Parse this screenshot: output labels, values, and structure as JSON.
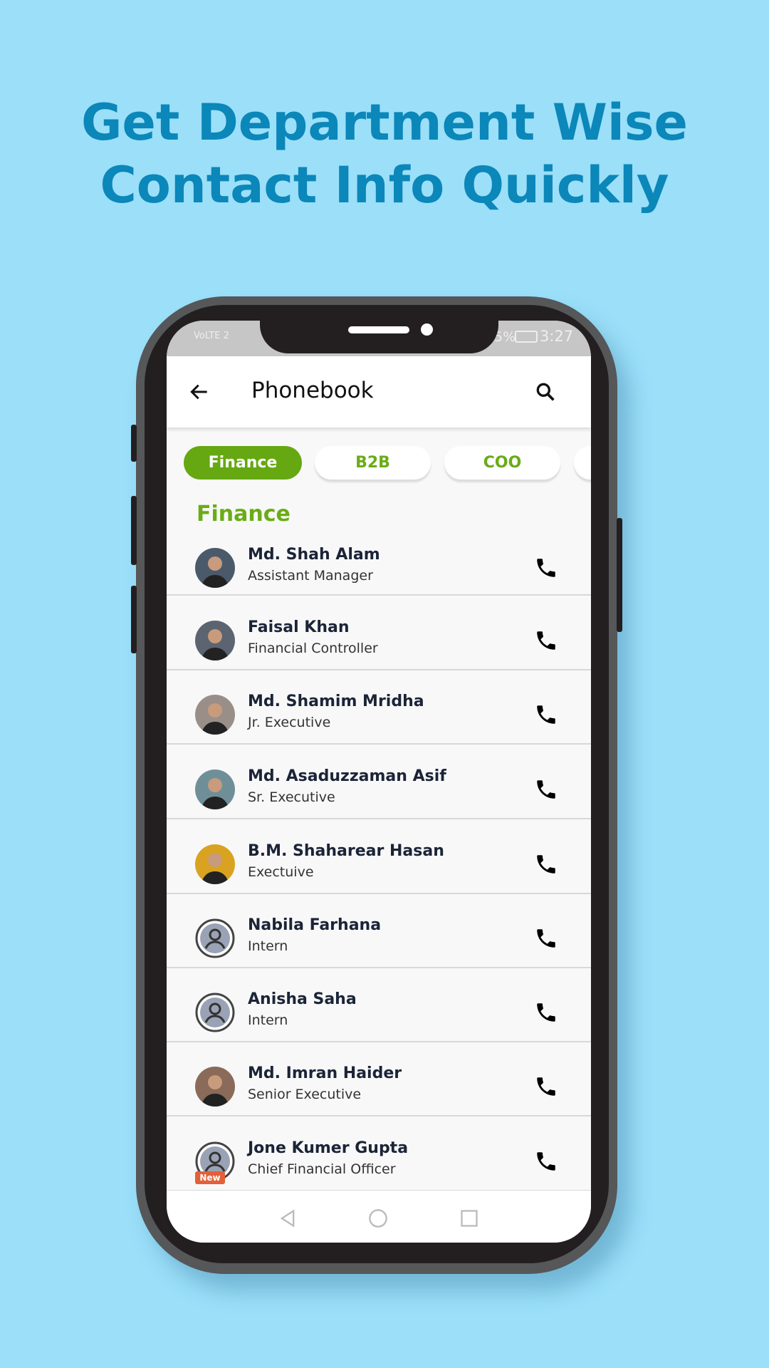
{
  "headline": {
    "line1": "Get Department Wise",
    "line2": "Contact Info Quickly"
  },
  "status_bar": {
    "left": "VoLTE 2",
    "battery": "5%",
    "time": "3:27"
  },
  "app_bar": {
    "title": "Phonebook",
    "back_icon": "arrow-left-icon",
    "search_icon": "search-icon"
  },
  "chips": [
    {
      "label": "Finance",
      "active": true
    },
    {
      "label": "B2B",
      "active": false
    },
    {
      "label": "COO",
      "active": false
    }
  ],
  "section_title": "Finance",
  "contacts": [
    {
      "name": "Md. Shah Alam",
      "role": "Assistant Manager",
      "avatar": "photo",
      "color": "#4a5a6a"
    },
    {
      "name": "Faisal Khan",
      "role": "Financial Controller",
      "avatar": "photo",
      "color": "#5b6470"
    },
    {
      "name": "Md. Shamim Mridha",
      "role": "Jr. Executive",
      "avatar": "photo",
      "color": "#9a8f88"
    },
    {
      "name": "Md. Asaduzzaman Asif",
      "role": "Sr. Executive",
      "avatar": "photo",
      "color": "#6f8f98"
    },
    {
      "name": "B.M. Shaharear Hasan",
      "role": "Exectuive",
      "avatar": "photo",
      "color": "#d9a321"
    },
    {
      "name": "Nabila Farhana",
      "role": "Intern",
      "avatar": "default",
      "color": "#9aa3b5"
    },
    {
      "name": "Anisha Saha",
      "role": "Intern",
      "avatar": "default",
      "color": "#9aa3b5"
    },
    {
      "name": "Md. Imran Haider",
      "role": "Senior Executive",
      "avatar": "photo",
      "color": "#8a6a58"
    },
    {
      "name": "Jone Kumer Gupta",
      "role": "Chief Financial Officer",
      "avatar": "default",
      "color": "#9aa3b5",
      "badge": "New"
    }
  ],
  "colors": {
    "background": "#9bdff9",
    "headline": "#0b87b9",
    "accent": "#65a812",
    "badge": "#e2603a"
  }
}
